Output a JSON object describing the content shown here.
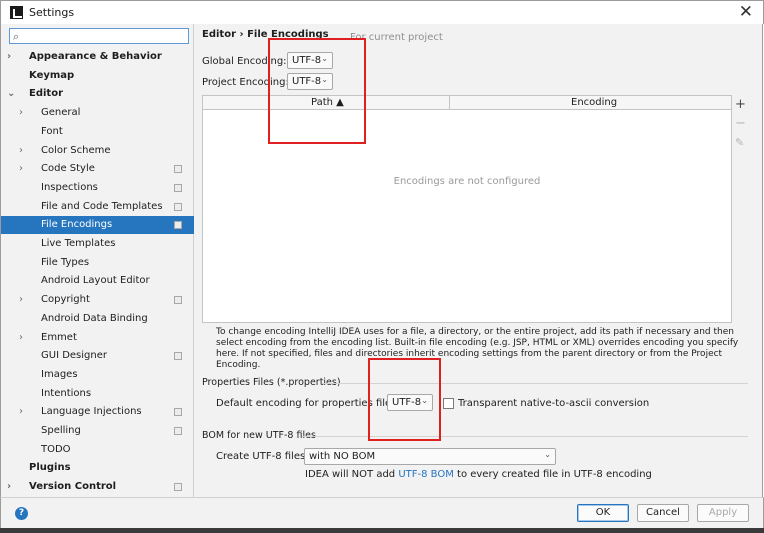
{
  "window": {
    "title": "Settings"
  },
  "sidebar": {
    "search_placeholder": "",
    "items": [
      {
        "label": "Appearance & Behavior",
        "bold": true,
        "arrow": "›",
        "level": 0,
        "copy": false,
        "selected": false
      },
      {
        "label": "Keymap",
        "bold": true,
        "arrow": "",
        "level": 0,
        "copy": false,
        "selected": false
      },
      {
        "label": "Editor",
        "bold": true,
        "arrow": "⌄",
        "level": 0,
        "copy": false,
        "selected": false
      },
      {
        "label": "General",
        "bold": false,
        "arrow": "›",
        "level": 1,
        "copy": false,
        "selected": false
      },
      {
        "label": "Font",
        "bold": false,
        "arrow": "",
        "level": 1,
        "copy": false,
        "selected": false
      },
      {
        "label": "Color Scheme",
        "bold": false,
        "arrow": "›",
        "level": 1,
        "copy": false,
        "selected": false
      },
      {
        "label": "Code Style",
        "bold": false,
        "arrow": "›",
        "level": 1,
        "copy": true,
        "selected": false
      },
      {
        "label": "Inspections",
        "bold": false,
        "arrow": "",
        "level": 1,
        "copy": true,
        "selected": false
      },
      {
        "label": "File and Code Templates",
        "bold": false,
        "arrow": "",
        "level": 1,
        "copy": true,
        "selected": false
      },
      {
        "label": "File Encodings",
        "bold": false,
        "arrow": "",
        "level": 1,
        "copy": true,
        "selected": true
      },
      {
        "label": "Live Templates",
        "bold": false,
        "arrow": "",
        "level": 1,
        "copy": false,
        "selected": false
      },
      {
        "label": "File Types",
        "bold": false,
        "arrow": "",
        "level": 1,
        "copy": false,
        "selected": false
      },
      {
        "label": "Android Layout Editor",
        "bold": false,
        "arrow": "",
        "level": 1,
        "copy": false,
        "selected": false
      },
      {
        "label": "Copyright",
        "bold": false,
        "arrow": "›",
        "level": 1,
        "copy": true,
        "selected": false
      },
      {
        "label": "Android Data Binding",
        "bold": false,
        "arrow": "",
        "level": 1,
        "copy": false,
        "selected": false
      },
      {
        "label": "Emmet",
        "bold": false,
        "arrow": "›",
        "level": 1,
        "copy": false,
        "selected": false
      },
      {
        "label": "GUI Designer",
        "bold": false,
        "arrow": "",
        "level": 1,
        "copy": true,
        "selected": false
      },
      {
        "label": "Images",
        "bold": false,
        "arrow": "",
        "level": 1,
        "copy": false,
        "selected": false
      },
      {
        "label": "Intentions",
        "bold": false,
        "arrow": "",
        "level": 1,
        "copy": false,
        "selected": false
      },
      {
        "label": "Language Injections",
        "bold": false,
        "arrow": "›",
        "level": 1,
        "copy": true,
        "selected": false
      },
      {
        "label": "Spelling",
        "bold": false,
        "arrow": "",
        "level": 1,
        "copy": true,
        "selected": false
      },
      {
        "label": "TODO",
        "bold": false,
        "arrow": "",
        "level": 1,
        "copy": false,
        "selected": false
      },
      {
        "label": "Plugins",
        "bold": true,
        "arrow": "",
        "level": 0,
        "copy": false,
        "selected": false
      },
      {
        "label": "Version Control",
        "bold": true,
        "arrow": "›",
        "level": 0,
        "copy": true,
        "selected": false
      }
    ]
  },
  "main": {
    "breadcrumb": "Editor  ›  File Encodings",
    "scope_note": "For current project",
    "global_encoding_label": "Global Encoding:",
    "global_encoding_value": "UTF-8",
    "project_encoding_label": "Project Encoding:",
    "project_encoding_value": "UTF-8",
    "table": {
      "col_path": "Path ▲",
      "col_encoding": "Encoding",
      "empty": "Encodings are not configured"
    },
    "toolbar": {
      "add": "+",
      "remove": "−",
      "edit": "✎"
    },
    "help_text": "To change encoding IntelliJ IDEA uses for a file, a directory, or the entire project, add its path if necessary and then select encoding from the encoding list. Built-in file encoding (e.g. JSP, HTML or XML) overrides encoding you specify here. If not specified, files and directories inherit encoding settings from the parent directory or from the Project Encoding.",
    "properties_section": "Properties Files (*.properties)",
    "default_props_label": "Default encoding for properties files:",
    "default_props_value": "UTF-8",
    "transparent_label": "Transparent native-to-ascii conversion",
    "bom_section": "BOM for new UTF-8 files",
    "create_utf8_label": "Create UTF-8 files:",
    "create_utf8_value": "with NO BOM",
    "bom_note_pre": "IDEA will NOT add ",
    "bom_note_link": "UTF-8 BOM",
    "bom_note_post": " to every created file in UTF-8 encoding"
  },
  "footer": {
    "help": "?",
    "ok": "OK",
    "cancel": "Cancel",
    "apply": "Apply"
  },
  "colors": {
    "accent": "#2675bf",
    "annotation": "#e02020"
  }
}
